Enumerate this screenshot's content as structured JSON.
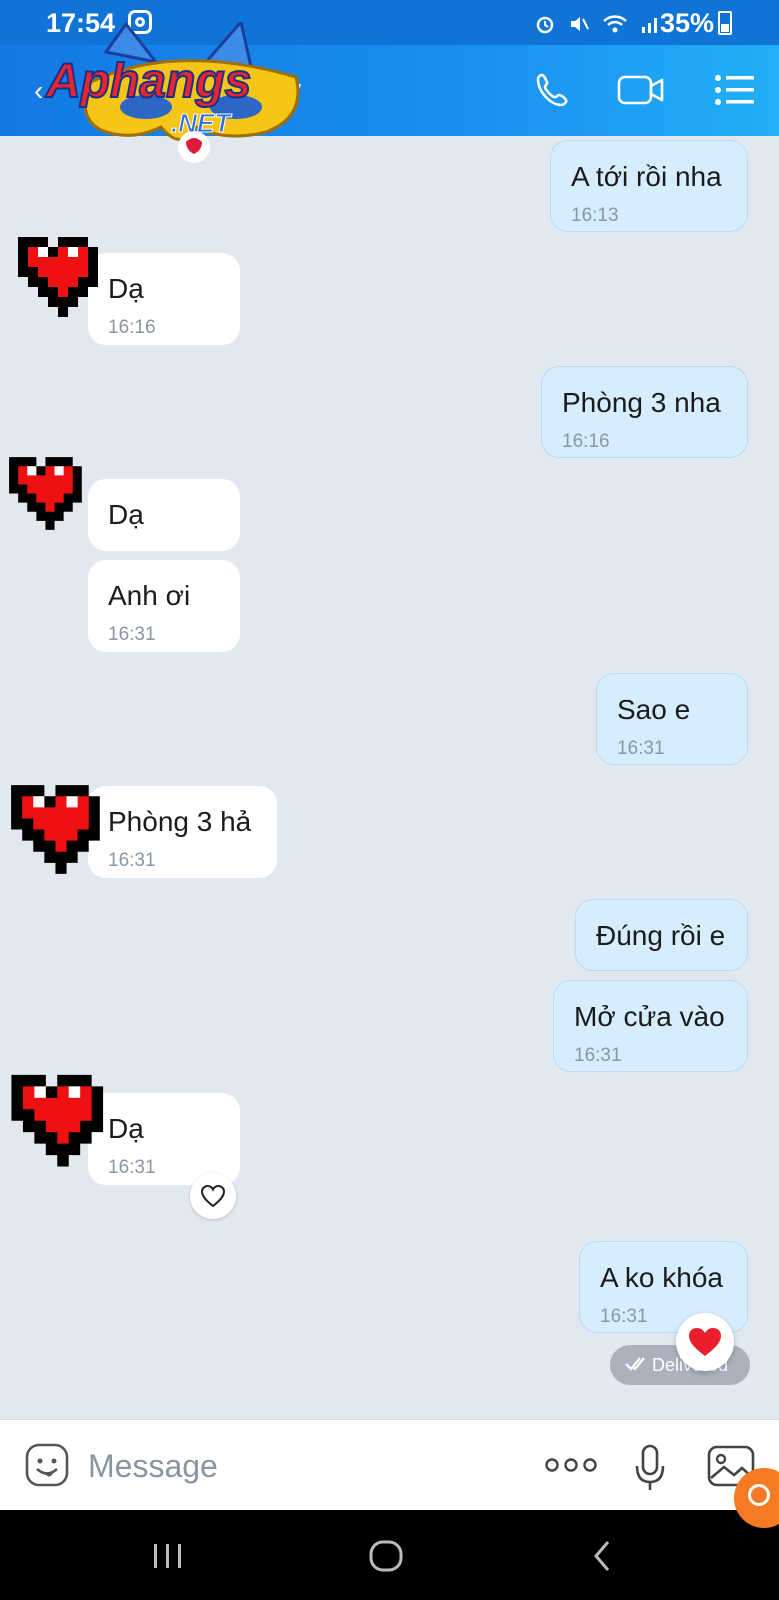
{
  "status_bar": {
    "time": "17:54",
    "battery": "35%",
    "icons": [
      "instagram-icon",
      "alarm-icon",
      "mute-icon",
      "wifi-icon",
      "signal-icon",
      "battery-icon"
    ]
  },
  "header": {
    "visible_title_fragment": "v",
    "watermark_text": [
      "Aphangs",
      ".NET"
    ],
    "actions": [
      "phone-icon",
      "video-icon",
      "menu-icon"
    ]
  },
  "messages": [
    {
      "side": "out",
      "text": "A tới rồi nha",
      "time": "16:13"
    },
    {
      "side": "in",
      "text": "Dạ",
      "time": "16:16"
    },
    {
      "side": "out",
      "text": "Phòng 3 nha",
      "time": "16:16"
    },
    {
      "side": "in",
      "text": "Dạ",
      "time": ""
    },
    {
      "side": "in",
      "text": "Anh ơi",
      "time": "16:31"
    },
    {
      "side": "out",
      "text": "Sao e",
      "time": "16:31"
    },
    {
      "side": "in",
      "text": "Phòng 3 hả",
      "time": "16:31"
    },
    {
      "side": "out",
      "text": "Đúng rồi e",
      "time": ""
    },
    {
      "side": "out",
      "text": "Mở cửa vào",
      "time": "16:31"
    },
    {
      "side": "in",
      "text": "Dạ",
      "time": "16:31"
    },
    {
      "side": "out",
      "text": "A ko khóa",
      "time": "16:31"
    }
  ],
  "status": {
    "delivered": "Delivered"
  },
  "input": {
    "placeholder": "Message"
  },
  "colors": {
    "header_blue": "#1379e3",
    "outgoing_bubble": "#d6edfd",
    "incoming_bubble": "#ffffff",
    "chat_bg": "#e2e8f0",
    "heart_red": "#ff0000"
  }
}
